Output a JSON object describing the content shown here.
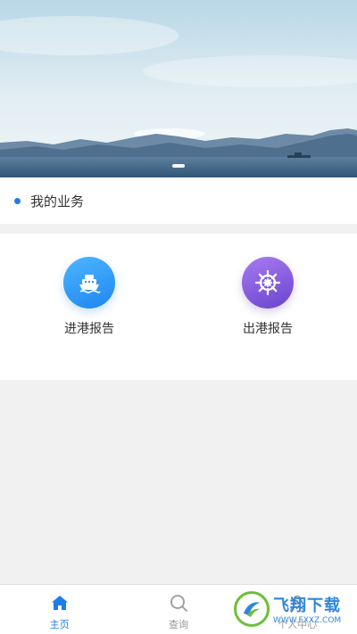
{
  "banner": {
    "image": "sea-harbor-mountains",
    "slide_count": 1,
    "active_slide": 1
  },
  "business": {
    "title": "我的业务",
    "accent": "#1e7de8"
  },
  "services": [
    {
      "label": "进港报告",
      "icon": "ship-icon",
      "color": "#2b8ef2"
    },
    {
      "label": "出港报告",
      "icon": "ship-wheel-icon",
      "color": "#7c55dd"
    }
  ],
  "tabbar": {
    "items": [
      {
        "label": "主页",
        "icon": "home-icon",
        "active": true
      },
      {
        "label": "查询",
        "icon": "search-icon",
        "active": false
      },
      {
        "label": "个人中心",
        "icon": "person-icon",
        "active": false
      }
    ],
    "active_color": "#1e7de8",
    "inactive_color": "#999999"
  },
  "watermark": {
    "title": "飞翔下载",
    "url": "WWW.FXXZ.COM"
  }
}
